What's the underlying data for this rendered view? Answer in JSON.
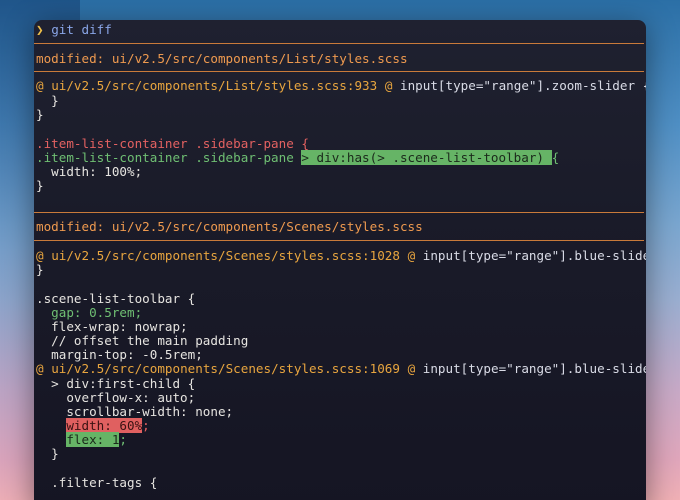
{
  "prompt": {
    "caret": "❯",
    "command": "git diff"
  },
  "diff": {
    "file1": {
      "header": "modified: ui/v2.5/src/components/List/styles.scss",
      "hunk_at1": "@",
      "hunk_path": "ui/v2.5/src/components/List/styles.scss:933",
      "hunk_at2": "@",
      "hunk_context": "input[type=\"range\"].zoom-slider {",
      "lines": [
        "  }",
        "}",
        "",
        ".item-list-container .sidebar-pane {",
        ".item-list-container .sidebar-pane ",
        "  width: 100%;",
        "}"
      ],
      "added_fragment": "> div:has(> .scene-list-toolbar) ",
      "added_tail": "{"
    },
    "file2": {
      "header": "modified: ui/v2.5/src/components/Scenes/styles.scss",
      "hunk1_at1": "@",
      "hunk1_path": "ui/v2.5/src/components/Scenes/styles.scss:1028",
      "hunk1_at2": "@",
      "hunk1_context": "input[type=\"range\"].blue-slider {",
      "hunk1_lines": [
        "}",
        "",
        ".scene-list-toolbar {",
        "  gap: 0.5rem;",
        "  flex-wrap: nowrap;",
        "  // offset the main padding",
        "  margin-top: -0.5rem;"
      ],
      "hunk2_at1": "@",
      "hunk2_path": "ui/v2.5/src/components/Scenes/styles.scss:1069",
      "hunk2_at2": "@",
      "hunk2_context": "input[type=\"range\"].blue-slider {",
      "hunk2_lines": [
        "  > div:first-child {",
        "    overflow-x: auto;",
        "    scrollbar-width: none;"
      ],
      "removed_indent": "    ",
      "removed_highlight": "width: 60%",
      "removed_tail": ";",
      "added_indent": "    ",
      "added_highlight": "flex: 1",
      "added_tail": ";",
      "closing_lines": [
        "  }",
        "",
        "  .filter-tags {"
      ]
    }
  }
}
